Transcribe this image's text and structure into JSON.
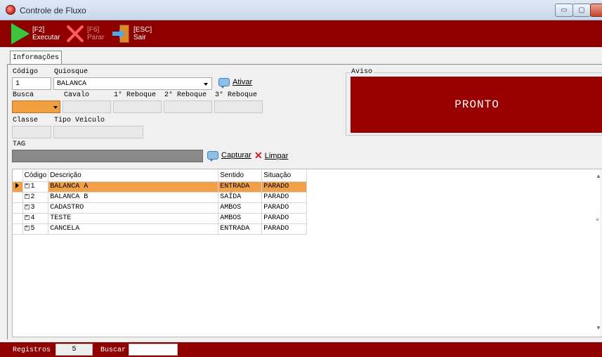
{
  "window": {
    "title": "Controle de Fluxo",
    "min_glyph": "▭",
    "max_glyph": "▢",
    "close_glyph": "✕"
  },
  "toolbar": {
    "executar": {
      "key": "[F2]",
      "label": "Executar",
      "icon": "play-icon"
    },
    "parar": {
      "key": "[F6]",
      "label": "Parar",
      "icon": "stop-icon"
    },
    "sair": {
      "key": "[ESC]",
      "label": "Sair",
      "icon": "exit-door-icon"
    }
  },
  "tabs": [
    {
      "label": "Informações"
    }
  ],
  "form": {
    "codigo": {
      "label": "Código",
      "value": "1"
    },
    "quiosque": {
      "label": "Quiosque",
      "value": "BALANCA"
    },
    "ativar_label": "Ativar",
    "busca": {
      "label": "Busca",
      "value": ""
    },
    "cavalo": {
      "label": "Cavalo",
      "value": ""
    },
    "reboque1": {
      "label": "1° Reboque",
      "value": ""
    },
    "reboque2": {
      "label": "2° Reboque",
      "value": ""
    },
    "reboque3": {
      "label": "3° Reboque",
      "value": ""
    },
    "classe": {
      "label": "Classe",
      "value": ""
    },
    "tipo_veiculo": {
      "label": "Tipo Veiculo",
      "value": ""
    },
    "tag": {
      "label": "TAG",
      "value": ""
    },
    "capturar_label": "Capturar",
    "limpar_label": "Limpar"
  },
  "aviso": {
    "label": "Aviso",
    "status": "PRONTO",
    "color": "#990000"
  },
  "grid": {
    "columns": [
      "Código",
      "Descrição",
      "Sentido",
      "Situação"
    ],
    "rows": [
      {
        "codigo": "1",
        "descricao": "BALANCA A",
        "sentido": "ENTRADA",
        "situacao": "PARADO"
      },
      {
        "codigo": "2",
        "descricao": "BALANCA B",
        "sentido": "SAÍDA",
        "situacao": "PARADO"
      },
      {
        "codigo": "3",
        "descricao": "CADASTRO",
        "sentido": "AMBOS",
        "situacao": "PARADO"
      },
      {
        "codigo": "4",
        "descricao": "TESTE",
        "sentido": "AMBOS",
        "situacao": "PARADO"
      },
      {
        "codigo": "5",
        "descricao": "CANCELA",
        "sentido": "ENTRADA",
        "situacao": "PARADO"
      }
    ],
    "selected_color": "#f0a048"
  },
  "statusbar": {
    "registros_label": "Registros",
    "registros_value": "5",
    "buscar_label": "Buscar",
    "buscar_value": ""
  },
  "colors": {
    "accent": "#8e0000"
  }
}
